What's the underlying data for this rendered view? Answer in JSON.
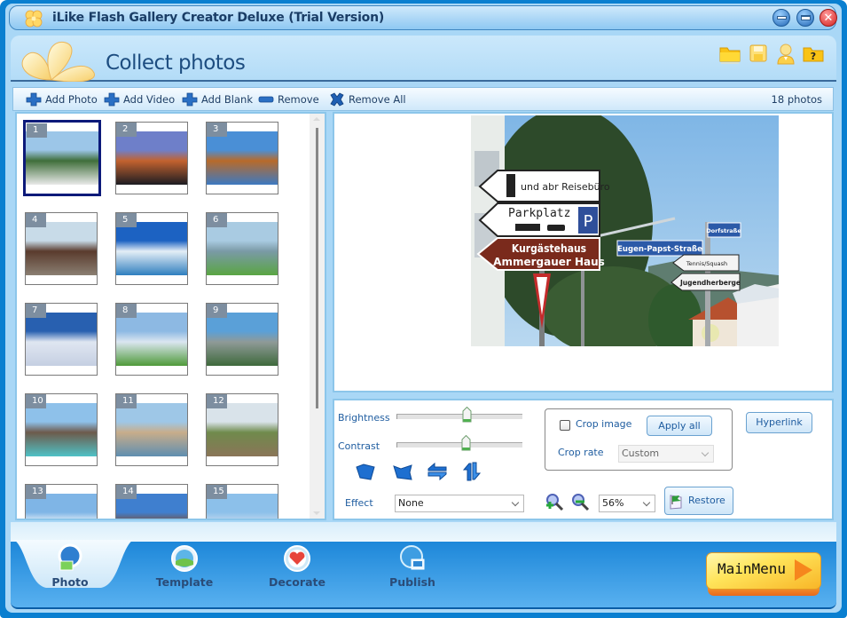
{
  "window": {
    "title": "iLike Flash Gallery Creator Deluxe (Trial Version)",
    "controls": [
      "minimize",
      "maximize",
      "close"
    ]
  },
  "header": {
    "title": "Collect photos",
    "icons": [
      "open-folder-icon",
      "save-icon",
      "user-icon",
      "help-icon"
    ]
  },
  "toolbar": {
    "add_photo": "Add Photo",
    "add_video": "Add Video",
    "add_blank": "Add Blank",
    "remove": "Remove",
    "remove_all": "Remove All",
    "photo_count": "18 photos"
  },
  "thumbnails": [
    {
      "num": "1",
      "selected": true,
      "colors": [
        "#9cc6e8",
        "#3f6e3a",
        "#e9e9e9"
      ]
    },
    {
      "num": "2",
      "selected": false,
      "colors": [
        "#6e7fc9",
        "#c3622f",
        "#1c1c22"
      ]
    },
    {
      "num": "3",
      "selected": false,
      "colors": [
        "#4a8fd6",
        "#b86a2a",
        "#3d79c1"
      ]
    },
    {
      "num": "4",
      "selected": false,
      "colors": [
        "#c8dbe8",
        "#5a3b2d",
        "#8a7f72"
      ]
    },
    {
      "num": "5",
      "selected": false,
      "colors": [
        "#1c62c2",
        "#e4eef6",
        "#2f7fbf"
      ]
    },
    {
      "num": "6",
      "selected": false,
      "colors": [
        "#a9cbe2",
        "#7a9aa6",
        "#5aa543"
      ]
    },
    {
      "num": "7",
      "selected": false,
      "colors": [
        "#2860b0",
        "#dfe6f1",
        "#c5cfe2"
      ]
    },
    {
      "num": "8",
      "selected": false,
      "colors": [
        "#8db9e3",
        "#dbe6f0",
        "#4f9a3a"
      ]
    },
    {
      "num": "9",
      "selected": false,
      "colors": [
        "#5aa0d8",
        "#8f9a98",
        "#3e6a3c"
      ]
    },
    {
      "num": "10",
      "selected": false,
      "colors": [
        "#8ec1ea",
        "#6d5a4b",
        "#4fc2c6"
      ]
    },
    {
      "num": "11",
      "selected": false,
      "colors": [
        "#9ec7e7",
        "#c8ad8a",
        "#5f8eb0"
      ]
    },
    {
      "num": "12",
      "selected": false,
      "colors": [
        "#d9e3ea",
        "#6f8a4c",
        "#8a7558"
      ]
    },
    {
      "num": "13",
      "selected": false,
      "colors": [
        "#7fb5e6",
        "#eef4f9",
        "#5c7e3c"
      ]
    },
    {
      "num": "14",
      "selected": false,
      "colors": [
        "#3f7fcf",
        "#7a4f3a",
        "#e0e8f0"
      ]
    },
    {
      "num": "15",
      "selected": false,
      "colors": [
        "#8cc0ea",
        "#c7dbee",
        "#6a5c52"
      ]
    }
  ],
  "preview": {
    "signs": {
      "sign1": "und abr Reisebüro",
      "sign2": "Parkplatz",
      "sign2_badge": "P",
      "sign3_line1": "Kurgästehaus",
      "sign3_line2": "Ammergauer Haus",
      "street1": "Eugen-Papst-Straße",
      "street2": "Dorfstraße",
      "sign4": "Tennis/Squash",
      "sign5": "Jugendherberge"
    }
  },
  "controls": {
    "brightness_label": "Brightness",
    "brightness_value": 0.55,
    "contrast_label": "Contrast",
    "contrast_value": 0.54,
    "rotate_buttons": [
      "rotate-left",
      "rotate-right",
      "flip-horizontal",
      "flip-vertical"
    ],
    "effect_label": "Effect",
    "effect_value": "None",
    "crop_image_label": "Crop image",
    "crop_image_checked": false,
    "apply_all_label": "Apply all",
    "crop_rate_label": "Crop rate",
    "crop_rate_value": "Custom",
    "hyperlink_label": "Hyperlink",
    "zoom_value": "56%",
    "restore_label": "Restore"
  },
  "bottom_nav": {
    "tabs": [
      {
        "label": "Photo",
        "active": true
      },
      {
        "label": "Template",
        "active": false
      },
      {
        "label": "Decorate",
        "active": false
      },
      {
        "label": "Publish",
        "active": false
      }
    ],
    "main_menu_label": "MainMenu"
  }
}
